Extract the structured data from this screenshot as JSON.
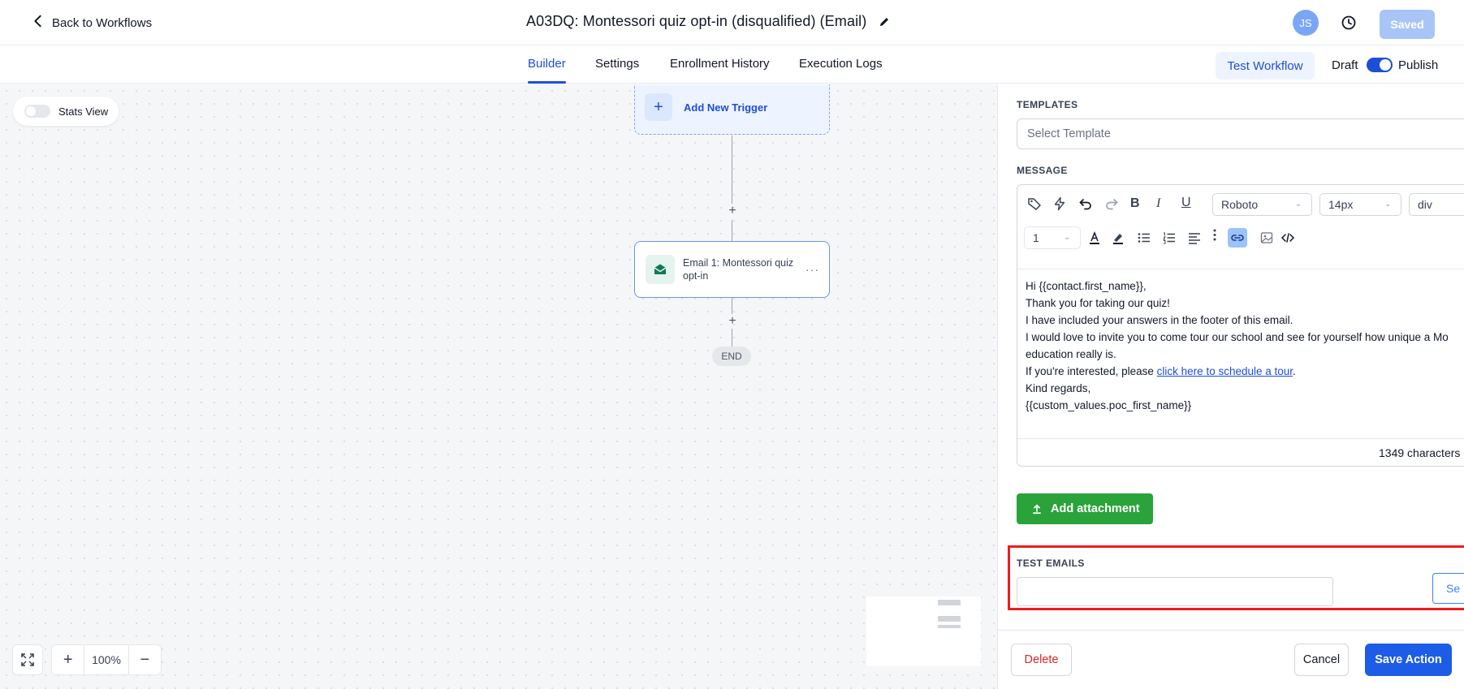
{
  "header": {
    "back_label": "Back to Workflows",
    "title": "A03DQ: Montessori quiz opt-in (disqualified) (Email)",
    "avatar_initials": "JS",
    "saved_label": "Saved"
  },
  "tabs": {
    "items": [
      "Builder",
      "Settings",
      "Enrollment History",
      "Execution Logs"
    ],
    "active": "Builder",
    "test_workflow_label": "Test Workflow",
    "draft_label": "Draft",
    "publish_label": "Publish"
  },
  "canvas": {
    "stats_view_label": "Stats View",
    "add_trigger_label": "Add New Trigger",
    "email_node_label": "Email 1: Montessori quiz opt-in",
    "end_label": "END",
    "zoom_level": "100%"
  },
  "panel": {
    "templates_label": "TEMPLATES",
    "select_template_placeholder": "Select Template",
    "message_label": "MESSAGE",
    "font_family": "Roboto",
    "font_size": "14px",
    "block_type": "div",
    "line_height_value": "1",
    "message_lines": {
      "l1": "Hi {{contact.first_name}},",
      "l2": "Thank you for taking our quiz!",
      "l3": "I have included your answers in the footer of this email.",
      "l4": "I would love to invite you to come tour our school and see for yourself how unique a Mo",
      "l5": "education really is.",
      "l6_prefix": "If you're interested, please ",
      "l6_link": "click here to schedule a tour",
      "l6_suffix": ".",
      "l7": "Kind regards,",
      "l8": "{{custom_values.poc_first_name}}"
    },
    "characters_count": "1349 characters",
    "add_attachment_label": "Add attachment",
    "test_emails_label": "TEST EMAILS",
    "send_label": "Se",
    "delete_label": "Delete",
    "cancel_label": "Cancel",
    "save_action_label": "Save Action"
  },
  "colors": {
    "accent": "#1d4ed8",
    "attachment_green": "#2aa33a",
    "highlight_red": "#ef1c1c",
    "delete_red": "#dc2626"
  }
}
